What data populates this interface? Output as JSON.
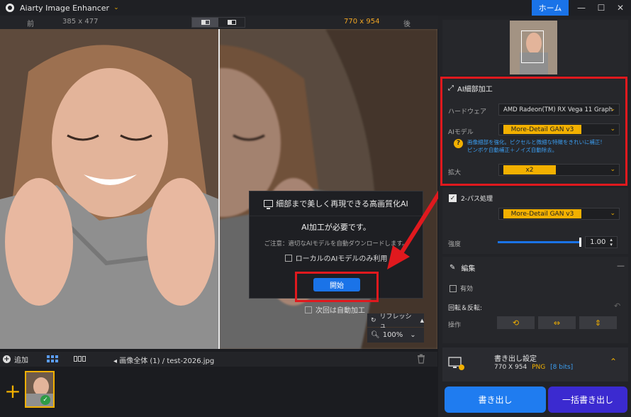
{
  "titlebar": {
    "app_title": "Aiarty Image Enhancer",
    "home_button": "ホーム",
    "minimize": "—",
    "maximize": "☐",
    "close": "✕"
  },
  "compare": {
    "before_label": "前",
    "before_size": "385 x 477",
    "after_size": "770 x 954",
    "after_label": "後"
  },
  "dialog": {
    "title": "細部まで美しく再現できる高画質化AI",
    "need_text": "AI加工が必要です。",
    "note_text": "ご注意：適切なAIモデルを自動ダウンロードします。",
    "local_only_label": "ローカルのAIモデルのみ利用",
    "start_button": "開始",
    "auto_next_label": "次回は自動加工"
  },
  "viewer": {
    "refresh_label": "リフレッシュ",
    "zoom_value": "100%"
  },
  "bottombar": {
    "add_label": "追加",
    "path_all": "画像全体 (1)",
    "path_sep": "/",
    "file_name": "test-2026.jpg"
  },
  "panel": {
    "ai_section_title": "AI細部加工",
    "hardware_label": "ハードウェア",
    "hardware_value": "AMD Radeon(TM) RX Vega 11 Graphi",
    "ai_model_label": "AIモデル",
    "ai_model_value": "More-Detail GAN  v3",
    "hint_line1": "画像細部を強化。ピクセルと微細な特徴をきれいに補正!",
    "hint_line2": "ピンボケ自動補正＋ノイズ自動除去。",
    "scale_label": "拡大",
    "scale_value": "x2",
    "two_pass_label": "2-パス処理",
    "two_pass_model": "More-Detail GAN  v3",
    "strength_label": "強度",
    "strength_value": "1.00",
    "strength_level": 1.0,
    "edit_title": "編集",
    "enable_label": "有効",
    "rotate_label": "回転＆反転:",
    "operation_label": "操作"
  },
  "export": {
    "title": "書き出し設定",
    "size": "770 X 954",
    "format": "PNG",
    "bits": "[8 bits]",
    "export_button": "書き出し",
    "batch_button": "一括書き出し"
  },
  "colors": {
    "accent_blue": "#1a73e8",
    "accent_yellow": "#f2b000",
    "highlight_red": "#e0191e",
    "batch_purple": "#3b2ad0"
  }
}
